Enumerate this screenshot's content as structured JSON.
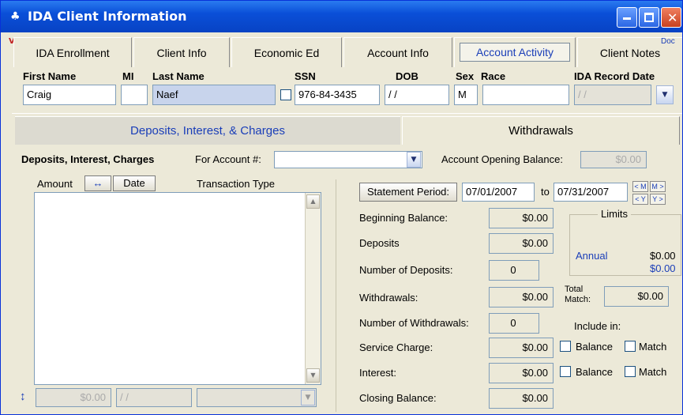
{
  "window": {
    "title": "IDA Client Information",
    "title_icon": "app-icon",
    "corner_text": "Doc",
    "corner_mark": "V"
  },
  "tabs": [
    {
      "label": "IDA Enrollment"
    },
    {
      "label": "Client Info"
    },
    {
      "label": "Economic Ed"
    },
    {
      "label": "Account Info"
    },
    {
      "label": "Account Activity",
      "active": true
    },
    {
      "label": "Client Notes"
    }
  ],
  "client": {
    "first_name_label": "First Name",
    "mi_label": "MI",
    "last_name_label": "Last Name",
    "ssn_label": "SSN",
    "dob_label": "DOB",
    "sex_label": "Sex",
    "race_label": "Race",
    "record_date_label": "IDA Record Date",
    "first_name": "Craig",
    "mi": "",
    "last_name": "Naef",
    "ssn": "976-84-3435",
    "dob": "/ /",
    "sex": "M",
    "race": "",
    "record_date": "/ /"
  },
  "subtabs": {
    "deposits": "Deposits, Interest, & Charges",
    "withdrawals": "Withdrawals"
  },
  "account_row": {
    "section_label": "Deposits, Interest, Charges",
    "for_account_label": "For Account #:",
    "account_value": "",
    "opening_balance_label": "Account Opening Balance:",
    "opening_balance": "$0.00"
  },
  "list": {
    "col_amount": "Amount",
    "col_sort_icon": "swap-arrows-icon",
    "col_date": "Date",
    "col_type": "Transaction Type",
    "footer_amount": "$0.00",
    "footer_date": "/ /",
    "footer_type": ""
  },
  "statement": {
    "button": "Statement Period:",
    "from": "07/01/2007",
    "to_label": "to",
    "to": "07/31/2007",
    "nav_m_prev": "< M",
    "nav_m_next": "M >",
    "nav_y_prev": "< Y",
    "nav_y_next": "Y >"
  },
  "summary": [
    {
      "label": "Beginning Balance:",
      "value": "$0.00"
    },
    {
      "label": "Deposits",
      "value": "$0.00"
    },
    {
      "label": "Number of Deposits:",
      "value": "0"
    },
    {
      "label": "Withdrawals:",
      "value": "$0.00"
    },
    {
      "label": "Number of Withdrawals:",
      "value": "0"
    },
    {
      "label": "Service Charge:",
      "value": "$0.00"
    },
    {
      "label": "Interest:",
      "value": "$0.00"
    },
    {
      "label": "Closing Balance:",
      "value": "$0.00"
    }
  ],
  "limits": {
    "title": "Limits",
    "annual_label": "Annual",
    "annual_value": "$0.00",
    "annual_value2": "$0.00",
    "total_match_label_1": "Total",
    "total_match_label_2": "Match:",
    "total_match": "$0.00",
    "include_in": "Include in:",
    "balance": "Balance",
    "match": "Match"
  }
}
